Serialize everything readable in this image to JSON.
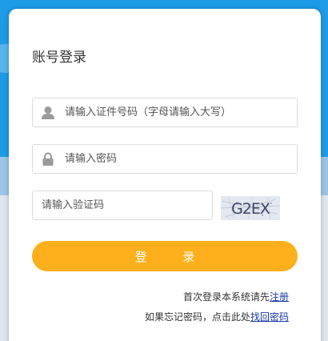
{
  "page": {
    "title": "账号登录"
  },
  "form": {
    "id_placeholder": "请输入证件号码（字母请输入大写）",
    "password_placeholder": "请输入密码",
    "captcha_placeholder": "请输入验证码",
    "captcha_text": "G2EX",
    "login_label": "登 录"
  },
  "links": {
    "register_prefix": "首次登录本系统请先",
    "register_link": "注册",
    "recover_prefix": "如果忘记密码，点击此处",
    "recover_link": "找回密码"
  },
  "icons": {
    "user": "user-icon",
    "lock": "lock-icon"
  },
  "colors": {
    "background": "#1e9be6",
    "button": "#fdb01b",
    "link": "#1a3aa8"
  }
}
